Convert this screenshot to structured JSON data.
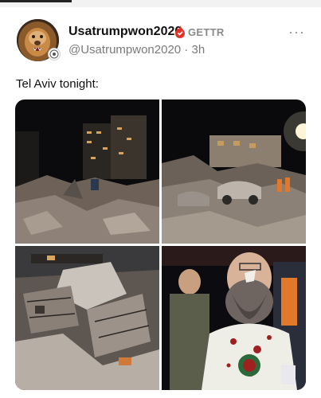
{
  "post": {
    "display_name": "Usatrumpwon2020",
    "platform_label": "GETTR",
    "handle": "@Usatrumpwon2020",
    "separator": " · ",
    "time": "3h",
    "more_label": "···",
    "text": "Tel Aviv tonight:"
  },
  "icons": {
    "avatar": "lion-avatar",
    "verified": "verified-flame-icon",
    "badge": "profile-badge-icon",
    "more": "more-options-icon"
  },
  "colors": {
    "verified": "#e0342a",
    "platform_label": "#8a8a8a",
    "handle": "#7a7a7a"
  },
  "media": [
    {
      "name": "photo-night-building-rubble"
    },
    {
      "name": "photo-wrecked-cars-debris"
    },
    {
      "name": "photo-collapsed-building"
    },
    {
      "name": "photo-injured-man"
    }
  ]
}
